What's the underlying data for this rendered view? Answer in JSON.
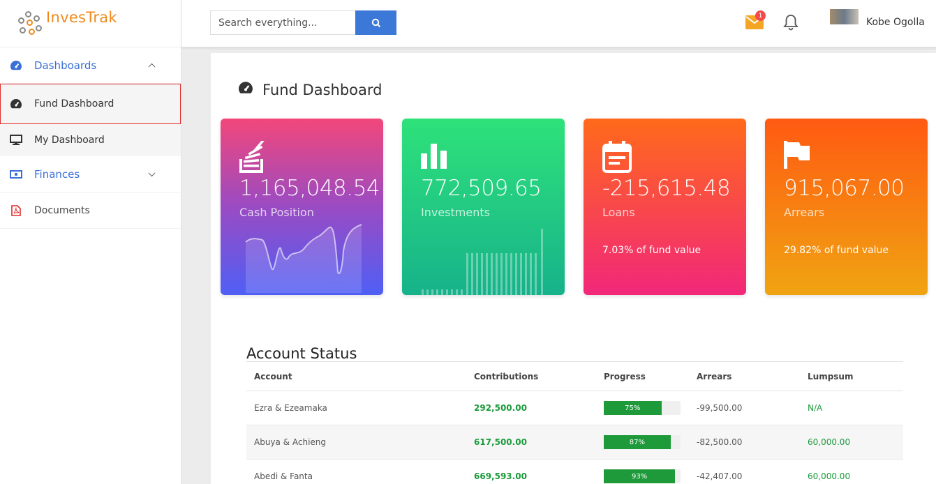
{
  "brand": {
    "name": "InvesTrak",
    "logo_icon": "dots-logo-icon"
  },
  "search": {
    "placeholder": "Search everything...",
    "button_icon": "search-icon"
  },
  "header": {
    "mail_badge": "1",
    "user_name": "Kobe Ogolla"
  },
  "sidebar": {
    "items": [
      {
        "label": "Dashboards",
        "icon": "gauge-icon",
        "expanded": true
      },
      {
        "label": "Fund Dashboard",
        "icon": "gauge-icon",
        "active": true
      },
      {
        "label": "My Dashboard",
        "icon": "monitor-icon"
      },
      {
        "label": "Finances",
        "icon": "money-icon",
        "expanded": false
      },
      {
        "label": "Documents",
        "icon": "pdf-icon"
      }
    ]
  },
  "page": {
    "title": "Fund Dashboard"
  },
  "cards": [
    {
      "value": "1,165,048.54",
      "label": "Cash Position",
      "icon": "stack-icon"
    },
    {
      "value": "772,509.65",
      "label": "Investments",
      "icon": "bar-chart-icon"
    },
    {
      "value": "-215,615.48",
      "label": "Loans",
      "note": "7.03% of fund value",
      "icon": "calendar-icon"
    },
    {
      "value": "915,067.00",
      "label": "Arrears",
      "note": "29.82% of fund value",
      "icon": "flag-icon"
    }
  ],
  "account_status": {
    "title": "Account Status",
    "columns": [
      "Account",
      "Contributions",
      "Progress",
      "Arrears",
      "Lumpsum"
    ],
    "rows": [
      {
        "account": "Ezra & Ezeamaka",
        "contributions": "292,500.00",
        "progress": "75%",
        "progress_value": 75,
        "arrears": "-99,500.00",
        "lumpsum": "N/A"
      },
      {
        "account": "Abuya & Achieng",
        "contributions": "617,500.00",
        "progress": "87%",
        "progress_value": 87,
        "arrears": "-82,500.00",
        "lumpsum": "60,000.00"
      },
      {
        "account": "Abedi & Fanta",
        "contributions": "669,593.00",
        "progress": "93%",
        "progress_value": 93,
        "arrears": "-42,407.00",
        "lumpsum": "60,000.00"
      }
    ]
  },
  "colors": {
    "accent": "#3c78d8",
    "brand": "#f08a1c",
    "positive": "#1a9a3a",
    "active_border": "#e02b2b"
  }
}
